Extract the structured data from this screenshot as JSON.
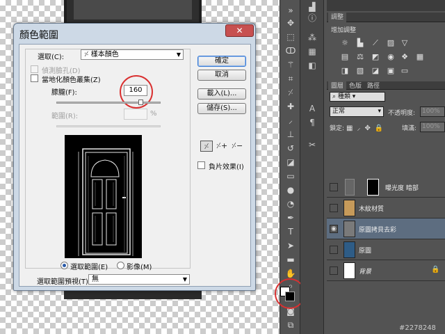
{
  "dialog": {
    "title": "顏色範圍",
    "close_label": "✕",
    "select_label": "選取(C):",
    "select_value": "樣本顏色",
    "detect_faces_label": "偵測臉孔(D)",
    "localized_clusters_label": "當地化顏色叢集(Z)",
    "fuzziness_label": "朦朧(F):",
    "fuzziness_value": "160",
    "range_label": "範圍(R):",
    "range_unit": "%",
    "radio_selection": "選取範圍(E)",
    "radio_image": "影像(M)",
    "preview_label": "選取範圍預視(T):",
    "preview_value": "無",
    "ok_button": "確定",
    "cancel_button": "取消",
    "load_button": "載入(L)...",
    "save_button": "儲存(S)...",
    "invert_label": "負片效果(I)"
  },
  "adjustments": {
    "tab": "調整",
    "title": "增加調整"
  },
  "layers": {
    "tabs": [
      "圖層",
      "色版",
      "路徑"
    ],
    "kind": "種類",
    "blend": "正常",
    "opacity_label": "不透明度:",
    "opacity_value": "100%",
    "lock_label": "鎖定:",
    "fill_label": "填滿:",
    "fill_value": "100%",
    "items": [
      {
        "name": "曝光度 暗部"
      },
      {
        "name": "木紋材質"
      },
      {
        "name": "原圖拷貝去彩"
      },
      {
        "name": "原圖"
      },
      {
        "name": "背景"
      }
    ]
  },
  "watermark": "#2278248",
  "colors": {
    "foreground": "#ffffff",
    "background": "#000000",
    "highlight_circle": "#d93030"
  }
}
